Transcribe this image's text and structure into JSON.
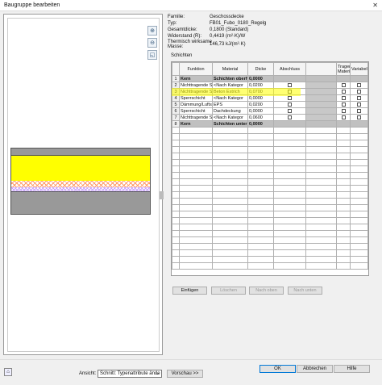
{
  "window": {
    "title": "Baugruppe bearbeiten",
    "close": "✕"
  },
  "info": {
    "familie_label": "Familie:",
    "familie_value": "Geschossdecke",
    "typ_label": "Typ:",
    "typ_value": "FB01_Fubo_0180_Regelg",
    "dicke_label": "Gesamtdicke:",
    "dicke_value": "0,1800 (Standard)",
    "widerstand_label": "Widerstand (R):",
    "widerstand_value": "0,4419 (m²·K)/W",
    "masse_label1": "Thermisch wirksame",
    "masse_label2": "Masse:",
    "masse_value": "146,73 kJ/(m²·K)"
  },
  "schichten_label": "Schichten",
  "table": {
    "headers": [
      "",
      "Funktion",
      "Material",
      "Dicke",
      "Abschluss",
      "Tragendes Material",
      "Variabel"
    ],
    "rows": [
      {
        "n": "1",
        "funktion": "Kern",
        "material": "Schichten oberh",
        "dicke": "0,0000",
        "core": true
      },
      {
        "n": "2",
        "funktion": "Nichttragende Sc",
        "material": "<Nach Kategor",
        "dicke": "0,0200"
      },
      {
        "n": "3",
        "funktion": "Nichttragende Sc",
        "material": "Beton Estrich",
        "dicke": "0,0700"
      },
      {
        "n": "4",
        "funktion": "Sperrschicht",
        "material": "<Nach Kategor",
        "dicke": "0,0000"
      },
      {
        "n": "5",
        "funktion": "Dämmung/Luftsc",
        "material": "EPS",
        "dicke": "0,0200"
      },
      {
        "n": "6",
        "funktion": "Sperrschicht",
        "material": "Dachdeckung",
        "dicke": "0,0000"
      },
      {
        "n": "7",
        "funktion": "Nichttragende Sc",
        "material": "<Nach Kategor",
        "dicke": "0,0600"
      },
      {
        "n": "8",
        "funktion": "Kern",
        "material": "Schichten unter",
        "dicke": "0,0000",
        "core": true
      }
    ]
  },
  "buttons": {
    "einfuegen": "Einfügen",
    "loeschen": "Löschen",
    "nach_oben": "Nach oben",
    "nach_unten": "Nach unten",
    "ansicht_label": "Ansicht:",
    "ansicht_value": "Schnitt: Typenattribute ände",
    "vorschau": "Vorschau >>",
    "ok": "OK",
    "abbrechen": "Abbrechen",
    "hilfe": "Hilfe"
  },
  "colors": {
    "highlight": "#ffff00",
    "core_row": "#c0c0c0",
    "section_grey": "#999999"
  },
  "icons": [
    "zoom-in-icon",
    "zoom-out-icon",
    "zoom-fit-icon",
    "help-corner-icon"
  ]
}
